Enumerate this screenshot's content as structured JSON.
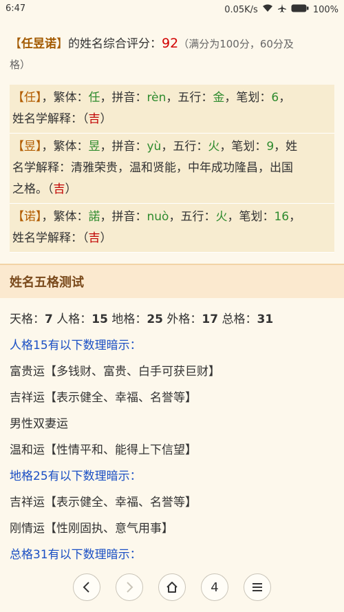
{
  "status": {
    "time": "6:47",
    "speed": "0.05K/s",
    "battery": "100%"
  },
  "summary": {
    "open": "【",
    "name": "任昱诺",
    "close": "】",
    "text": "的姓名综合评分：",
    "score": "92",
    "note_line1": "（满分为100分，60分及",
    "note_line2": "格）"
  },
  "characters": [
    {
      "char": "任",
      "line1_a": "，繁体：",
      "trad": "任",
      "line1_b": "，拼音：",
      "pinyin": "rèn",
      "line1_c": "，五行：",
      "wuxing": "金",
      "line1_d": "，笔划：",
      "strokes": "6",
      "line1_e": "，",
      "line2_a": "姓名学解释：（",
      "ji": "吉",
      "line2_b": "）",
      "explain": ""
    },
    {
      "char": "昱",
      "line1_a": "，繁体：",
      "trad": "昱",
      "line1_b": "，拼音：",
      "pinyin": "yù",
      "line1_c": "，五行：",
      "wuxing": "火",
      "line1_d": "，笔划：",
      "strokes": "9",
      "line1_e": "，姓",
      "line2_a": "名学解释：清雅荣贵，温和贤能，中年成功隆昌，出国",
      "line3_a": "之格。（",
      "ji": "吉",
      "line3_b": "）"
    },
    {
      "char": "诺",
      "line1_a": "，繁体：",
      "trad": "諾",
      "line1_b": "，拼音：",
      "pinyin": "nuò",
      "line1_c": "，五行：",
      "wuxing": "火",
      "line1_d": "，笔划：",
      "strokes": "16",
      "line1_e": "，",
      "line2_a": "姓名学解释：（",
      "ji": "吉",
      "line2_b": "）"
    }
  ],
  "wuge": {
    "title": "姓名五格测试",
    "tian_label": "天格：",
    "tian": "7",
    "ren_label": "人格：",
    "ren": "15",
    "di_label": "地格：",
    "di": "25",
    "wai_label": "外格：",
    "wai": "17",
    "zong_label": "总格：",
    "zong": "31",
    "rows": [
      {
        "text": "人格15有以下数理暗示：",
        "blue": true
      },
      {
        "text": "富贵运【多钱财、富贵、白手可获巨财】",
        "blue": false
      },
      {
        "text": "吉祥运【表示健全、幸福、名誉等】",
        "blue": false
      },
      {
        "text": "男性双妻运",
        "blue": false
      },
      {
        "text": "温和运【性情平和、能得上下信望】",
        "blue": false
      },
      {
        "text": "地格25有以下数理暗示：",
        "blue": true
      },
      {
        "text": "吉祥运【表示健全、幸福、名誉等】",
        "blue": false
      },
      {
        "text": "刚情运【性刚固执、意气用事】",
        "blue": false
      },
      {
        "text": "总格31有以下数理暗示：",
        "blue": true
      }
    ]
  },
  "nav": {
    "back_icon": "‹",
    "forward_icon": "›",
    "home_icon": "⌂",
    "tabs_count": "4",
    "menu_icon": "≡"
  }
}
